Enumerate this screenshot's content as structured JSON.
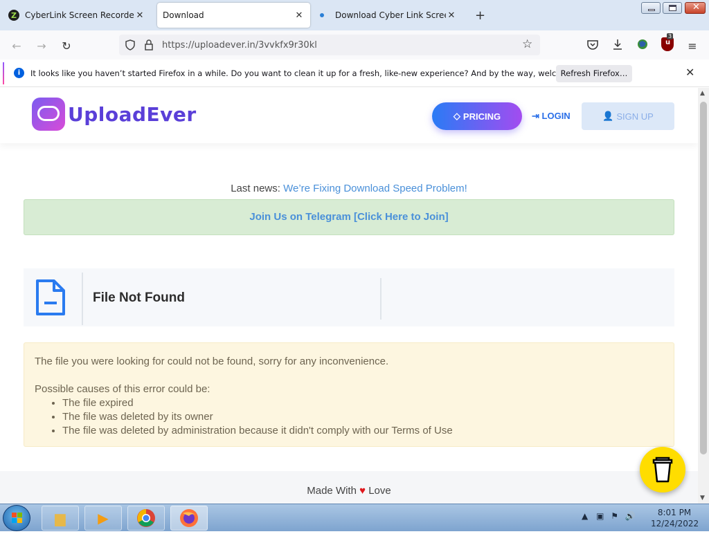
{
  "browser": {
    "tabs": [
      {
        "title": "CyberLink Screen Recorder Delu",
        "icon": "cyberlink-icon"
      },
      {
        "title": "Download",
        "icon": "none",
        "active": true
      },
      {
        "title": "Download Cyber Link Screen Re",
        "icon": "loading-dot-icon"
      }
    ],
    "url": "https://uploadever.in/3vvkfx9r30kl",
    "extension_badge": "3"
  },
  "notification": {
    "message": "It looks like you haven’t started Firefox in a while. Do you want to clean it up for a fresh, like-new experience? And by the way, welcome back!",
    "button": "Refresh Firefox…"
  },
  "site": {
    "logo_text": "UploadEver",
    "nav": {
      "pricing": "PRICING",
      "login": "LOGIN",
      "signup": "SIGN UP"
    },
    "last_news_label": "Last news:",
    "last_news_link": "We’re Fixing Download Speed Problem!",
    "telegram": "Join Us on Telegram [Click Here to Join]",
    "file_title": "File Not Found",
    "error": {
      "intro": "The file you were looking for could not be found, sorry for any inconvenience.",
      "causes_title": "Possible causes of this error could be:",
      "causes": [
        "The file expired",
        "The file was deleted by its owner",
        "The file was deleted by administration because it didn't comply with our Terms of Use"
      ]
    },
    "footer": {
      "pre": "Made With",
      "post": "Love"
    }
  },
  "taskbar": {
    "time": "8:01 PM",
    "date": "12/24/2022"
  },
  "colors": {
    "accent_blue": "#2a6fe8",
    "telegram_bg": "#d8ecd4",
    "error_bg": "#fdf6e0",
    "coffee_yellow": "#ffdd00"
  }
}
